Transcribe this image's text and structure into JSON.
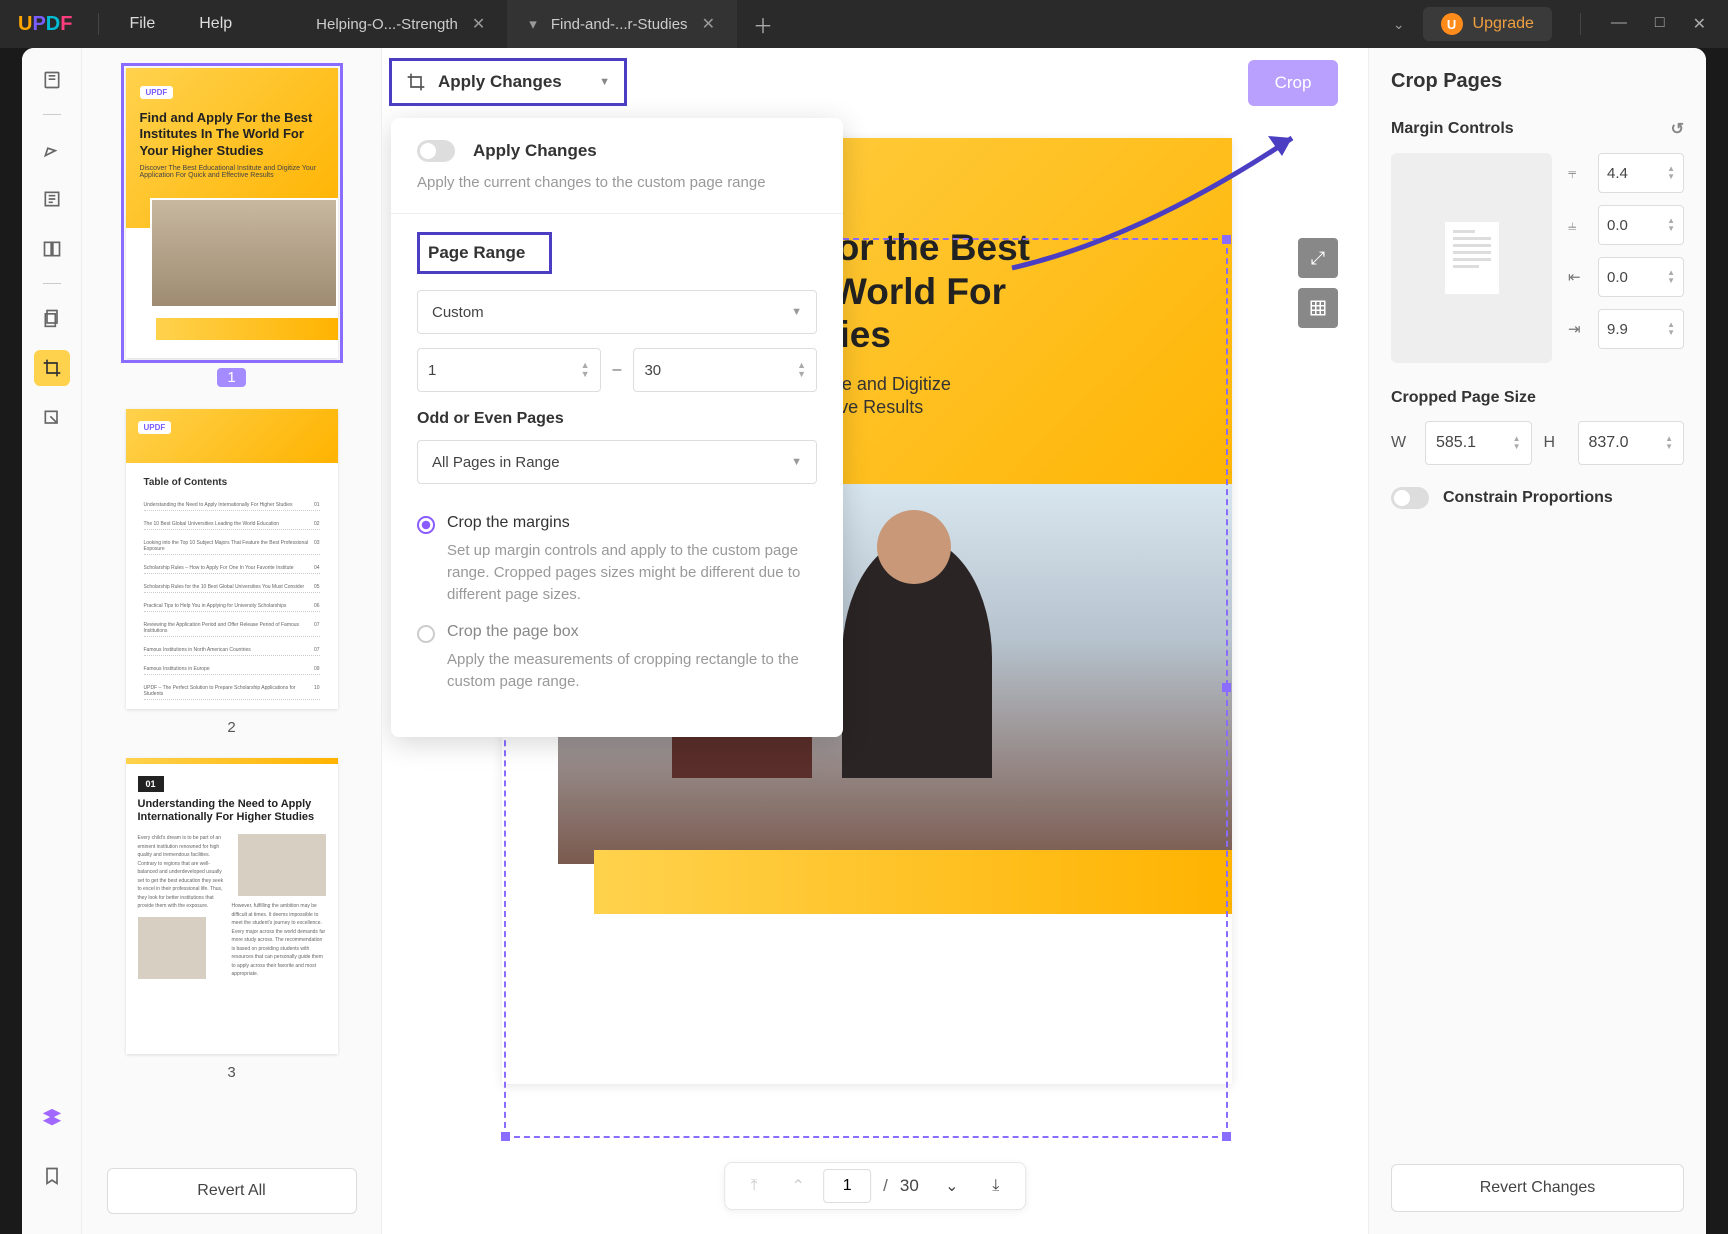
{
  "titlebar": {
    "menu_file": "File",
    "menu_help": "Help",
    "tab1": "Helping-O...-Strength",
    "tab2": "Find-and-...r-Studies",
    "upgrade": "Upgrade"
  },
  "thumbs": {
    "p1": "1",
    "p2": "2",
    "p3": "3",
    "revert_all": "Revert All",
    "t1_logo": "UPDF",
    "t1_title": "Find and Apply For the Best Institutes In The World For Your Higher Studies",
    "t1_sub": "Discover The Best Educational Institute and Digitize Your Application For Quick and Effective Results",
    "t2_h": "Table of Contents",
    "t3_num": "01",
    "t3_h": "Understanding the Need to Apply Internationally For Higher Studies"
  },
  "apply": {
    "btn": "Apply Changes",
    "toggle_label": "Apply Changes",
    "toggle_sub": "Apply the current changes to the custom page range",
    "page_range": "Page Range",
    "select": "Custom",
    "from": "1",
    "dash": "–",
    "to": "30",
    "odd_even": "Odd or Even Pages",
    "oe_select": "All Pages in Range",
    "opt1": "Crop the margins",
    "opt1_sub": "Set up margin controls and apply to the custom page range. Cropped pages sizes might be different due to different page sizes.",
    "opt2": "Crop the page box",
    "opt2_sub": "Apply the measurements of cropping rectangle to the custom page range."
  },
  "canvas": {
    "crop": "Crop",
    "page_title": "Find and Apply For the Best Institutes In The World For Your Higher Studies",
    "page_sub1": "Discover The Best Educational Institute and Digitize",
    "page_sub2": "Your Application For Quick and Effective Results"
  },
  "pager": {
    "cur": "1",
    "sep": "/",
    "total": "30"
  },
  "right": {
    "h1": "Crop Pages",
    "margin": "Margin Controls",
    "m_top": "4.4",
    "m_bottom": "0.0",
    "m_left": "0.0",
    "m_right": "9.9",
    "size_h": "Cropped Page Size",
    "w_label": "W",
    "w_val": "585.1",
    "h_label": "H",
    "h_val": "837.0",
    "constrain": "Constrain Proportions",
    "revert": "Revert Changes"
  }
}
